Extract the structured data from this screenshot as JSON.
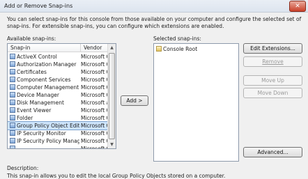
{
  "window": {
    "title": "Add or Remove Snap-ins",
    "close_glyph": "✕"
  },
  "intro_text": "You can select snap-ins for this console from those available on your computer and configure the selected set of snap-ins. For extensible snap-ins, you can configure which extensions are enabled.",
  "available": {
    "label": "Available snap-ins:",
    "columns": {
      "snapin": "Snap-in",
      "vendor": "Vendor"
    },
    "rows": [
      {
        "name": "ActiveX Control",
        "vendor": "Microsoft Cor"
      },
      {
        "name": "Authorization Manager",
        "vendor": "Microsoft Cor"
      },
      {
        "name": "Certificates",
        "vendor": "Microsoft Cor"
      },
      {
        "name": "Component Services",
        "vendor": "Microsoft Cor"
      },
      {
        "name": "Computer Management",
        "vendor": "Microsoft Cor"
      },
      {
        "name": "Device Manager",
        "vendor": "Microsoft Cor"
      },
      {
        "name": "Disk Management",
        "vendor": "Microsoft and"
      },
      {
        "name": "Event Viewer",
        "vendor": "Microsoft Cor"
      },
      {
        "name": "Folder",
        "vendor": "Microsoft Cor"
      },
      {
        "name": "Group Policy Object Editor",
        "vendor": "Microsoft Cor"
      },
      {
        "name": "IP Security Monitor",
        "vendor": "Microsoft Cor"
      },
      {
        "name": "IP Security Policy Manag...",
        "vendor": "Microsoft Cor"
      },
      {
        "name": "",
        "vendor": "Microsoft Cor"
      }
    ],
    "selected_index": 9
  },
  "add_button": "Add >",
  "selected": {
    "label": "Selected snap-ins:",
    "root": "Console Root"
  },
  "buttons": {
    "edit_extensions": "Edit Extensions...",
    "remove": "Remove",
    "move_up": "Move Up",
    "move_down": "Move Down",
    "advanced": "Advanced..."
  },
  "description": {
    "label": "Description:",
    "text": "This snap-in allows you to edit the local Group Policy Objects stored on a computer."
  }
}
